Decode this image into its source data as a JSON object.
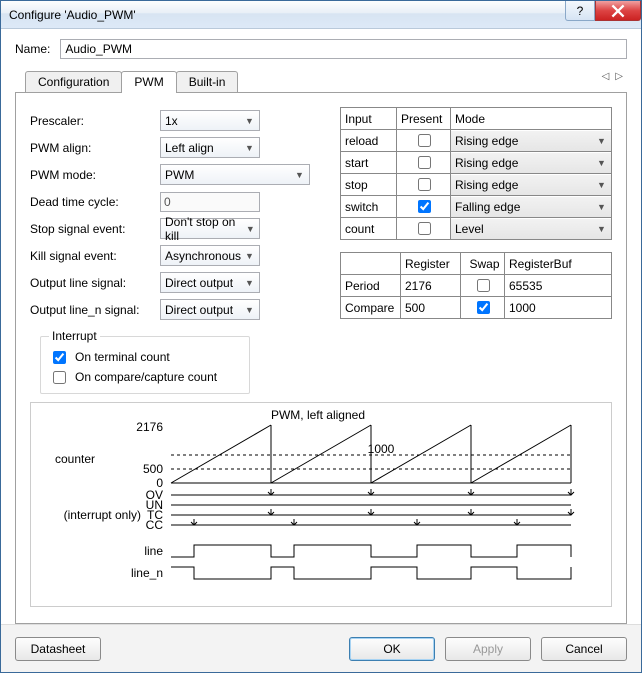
{
  "window": {
    "title": "Configure 'Audio_PWM'"
  },
  "name": {
    "label": "Name:",
    "value": "Audio_PWM"
  },
  "tabs": {
    "items": [
      "Configuration",
      "PWM",
      "Built-in"
    ],
    "active": 1
  },
  "form": {
    "prescaler": {
      "label": "Prescaler:",
      "value": "1x"
    },
    "pwm_align": {
      "label": "PWM align:",
      "value": "Left align"
    },
    "pwm_mode": {
      "label": "PWM mode:",
      "value": "PWM"
    },
    "dead_time": {
      "label": "Dead time cycle:",
      "value": "0"
    },
    "stop_signal": {
      "label": "Stop signal event:",
      "value": "Don't stop on kill"
    },
    "kill_signal": {
      "label": "Kill signal event:",
      "value": "Asynchronous"
    },
    "output_line": {
      "label": "Output line signal:",
      "value": "Direct output"
    },
    "output_line_n": {
      "label": "Output line_n signal:",
      "value": "Direct output"
    }
  },
  "interrupt": {
    "legend": "Interrupt",
    "terminal": {
      "label": "On terminal count",
      "checked": true
    },
    "compare": {
      "label": "On compare/capture count",
      "checked": false
    }
  },
  "input_table": {
    "headers": [
      "Input",
      "Present",
      "Mode"
    ],
    "rows": [
      {
        "input": "reload",
        "present": false,
        "mode": "Rising edge"
      },
      {
        "input": "start",
        "present": false,
        "mode": "Rising edge"
      },
      {
        "input": "stop",
        "present": false,
        "mode": "Rising edge"
      },
      {
        "input": "switch",
        "present": true,
        "mode": "Falling edge"
      },
      {
        "input": "count",
        "present": false,
        "mode": "Level"
      }
    ]
  },
  "register_table": {
    "headers": [
      "",
      "Register",
      "Swap",
      "RegisterBuf"
    ],
    "rows": [
      {
        "name": "Period",
        "register": "2176",
        "swap": false,
        "registerbuf": "65535"
      },
      {
        "name": "Compare",
        "register": "500",
        "swap": true,
        "registerbuf": "1000"
      }
    ]
  },
  "diagram": {
    "title": "PWM, left aligned",
    "labels": {
      "counter": "counter",
      "ov": "OV",
      "un": "UN",
      "tc": "TC",
      "tc_note": "(interrupt only)",
      "cc": "CC",
      "line": "line",
      "line_n": "line_n"
    },
    "ticks": {
      "top": "2176",
      "mid": "500",
      "bot": "0",
      "inner": "1000"
    }
  },
  "chart_data": {
    "type": "line",
    "title": "PWM, left aligned",
    "period": 2176,
    "compare": 500,
    "compare_buf": 1000,
    "cycles": 4,
    "swap_after_cycle": 2,
    "counter": {
      "ylim": [
        0,
        2176
      ],
      "yticks": [
        0,
        500,
        2176
      ],
      "annotation": "1000",
      "description": "sawtooth ramp 0→2176 repeated 4 times"
    },
    "signals": [
      {
        "name": "OV",
        "events_at": "end of each cycle (counter==TOP)",
        "marker": "↓"
      },
      {
        "name": "UN",
        "events_at": "none shown",
        "line": "flat"
      },
      {
        "name": "TC",
        "note": "(interrupt only)",
        "events_at": "end of each cycle",
        "marker": "↓"
      },
      {
        "name": "CC",
        "events_at": "counter==compare each cycle",
        "marker": "↓"
      },
      {
        "name": "line",
        "waveform": "high until compare, low until period; compare=500 for cycles 1-2, 1000 for cycles 3-4"
      },
      {
        "name": "line_n",
        "waveform": "complement of line"
      }
    ]
  },
  "buttons": {
    "datasheet": "Datasheet",
    "ok": "OK",
    "apply": "Apply",
    "cancel": "Cancel"
  }
}
